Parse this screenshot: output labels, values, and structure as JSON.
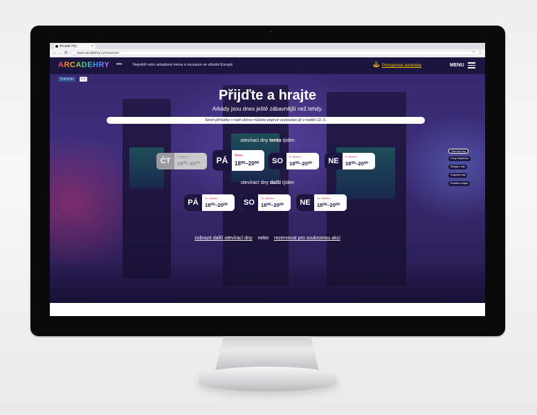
{
  "browser": {
    "tab_title": "Arcade Hry",
    "url": "www.arcadehry.cz/muzeum",
    "nav": {
      "back": "←",
      "forward": "→",
      "reload": "⟳"
    }
  },
  "site": {
    "logo": "ARCADEHRY",
    "tagline": "Největší retro arkádová herna a muzeum ve střední Evropě",
    "rent_link": "Pronajmout automaty",
    "menu_label": "MENU",
    "social": {
      "facebook": "To se mi líbí",
      "gplus": "G+1"
    }
  },
  "hero": {
    "title": "Přijďte a hrajte",
    "subtitle": "Arkády jsou dnes ještě zábavnější než tehdy.",
    "notice": "Nové přírůstky v naší sbírce můžete poprvé vyzkoušet již v neděli 13. 3."
  },
  "this_week": {
    "label_prefix": "otevírací dny",
    "label_bold": "tento",
    "label_suffix": "týden",
    "days": [
      {
        "abbr": "ČT",
        "date": "3. březen",
        "hours": "18⁰⁰–20⁰⁰",
        "state": "past"
      },
      {
        "abbr": "PÁ",
        "date": "dnes",
        "hours": "18⁰⁰–20⁰⁰",
        "state": "today"
      },
      {
        "abbr": "SO",
        "date": "5. březen",
        "hours": "18⁰⁰–20⁰⁰",
        "state": "upcoming"
      },
      {
        "abbr": "NE",
        "date": "6. březen",
        "hours": "18⁰⁰–20⁰⁰",
        "state": "upcoming"
      }
    ]
  },
  "next_week": {
    "label_prefix": "otevírací dny",
    "label_bold": "další",
    "label_suffix": "týden",
    "days": [
      {
        "abbr": "PÁ",
        "date": "11. březen",
        "hours": "18⁰⁰–20⁰⁰"
      },
      {
        "abbr": "SO",
        "date": "12. březen",
        "hours": "18⁰⁰–20⁰⁰"
      },
      {
        "abbr": "NE",
        "date": "13. březen",
        "hours": "18⁰⁰–20⁰⁰"
      }
    ]
  },
  "links": {
    "more_days": "zobrazit další otevírací dny",
    "or": "nebo",
    "reserve": "rezervovat pro soukromou akci"
  },
  "side_nav": [
    {
      "label": "Otevírací dny",
      "active": true
    },
    {
      "label": "Ceny vstupenek",
      "active": false
    },
    {
      "label": "Střípky z nás",
      "active": false
    },
    {
      "label": "Podpořte nás",
      "active": false
    },
    {
      "label": "Kontakt a mapa",
      "active": false
    }
  ],
  "colors": {
    "accent": "#e0215b",
    "navy": "#1c1540",
    "rent": "#f5c400"
  }
}
